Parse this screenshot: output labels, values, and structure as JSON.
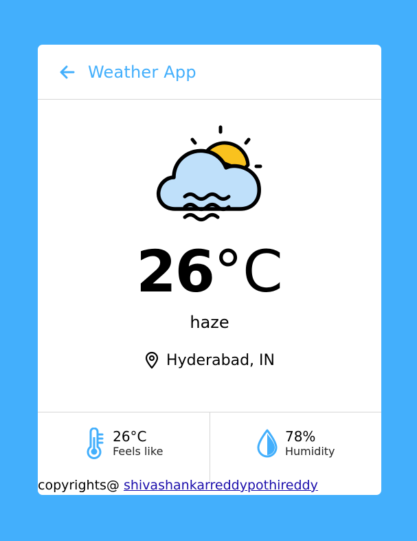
{
  "header": {
    "back_icon": "arrow-left-icon",
    "title": "Weather App"
  },
  "weather": {
    "icon": "haze-cloud-sun-icon",
    "temperature": "26",
    "unit": "°C",
    "description": "haze",
    "location_icon": "map-pin-icon",
    "location": "Hyderabad, IN"
  },
  "stats": [
    {
      "icon": "thermometer-icon",
      "value": "26°C",
      "label": "Feels like"
    },
    {
      "icon": "droplet-icon",
      "value": "78%",
      "label": "Humidity"
    }
  ],
  "footer": {
    "prefix": "copyrights@ ",
    "link_text": "shivashankarreddypothireddy"
  },
  "colors": {
    "accent": "#43AFFC",
    "cloud": "#BFE0FA",
    "sun": "#F9C21E"
  }
}
